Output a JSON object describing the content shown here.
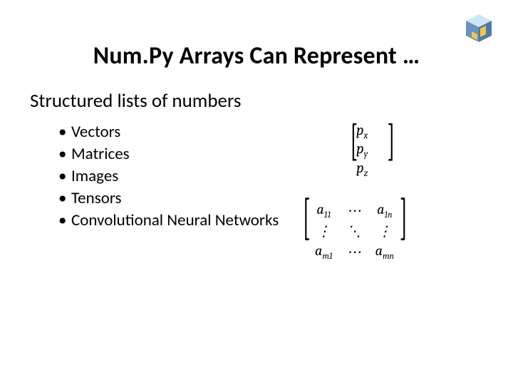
{
  "title": "Num.Py Arrays Can Represent …",
  "subhead": "Structured lists of numbers",
  "bullets": [
    "Vectors",
    "Matrices",
    "Images",
    "Tensors",
    "Convolutional Neural Networks"
  ],
  "vector": {
    "p": "p",
    "subs": [
      "x",
      "y",
      "z"
    ]
  },
  "matrix": {
    "a": "a",
    "tl": "11",
    "tr": "1n",
    "bl": "m1",
    "br": "mn",
    "dots_h": "⋯",
    "dots_v": "⋮",
    "dots_d": "⋱"
  }
}
